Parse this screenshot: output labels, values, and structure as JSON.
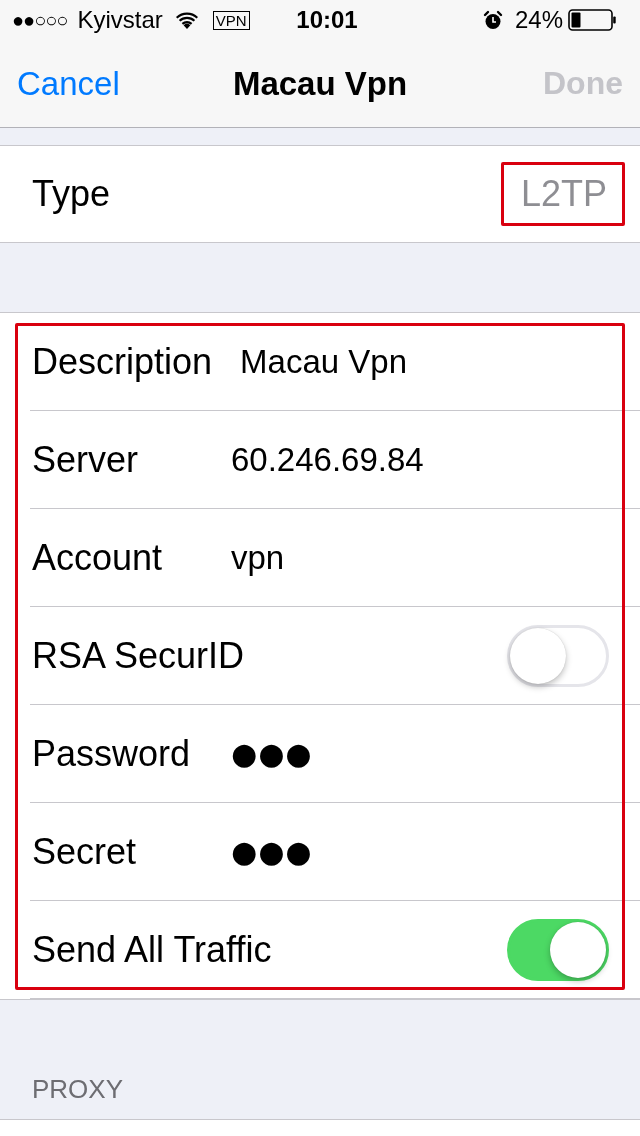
{
  "status_bar": {
    "signal": "●●○○○",
    "carrier": "Kyivstar",
    "vpn": "VPN",
    "time": "10:01",
    "battery": "24%"
  },
  "nav_bar": {
    "cancel": "Cancel",
    "title": "Macau Vpn",
    "done": {
      "label": "Done",
      "disabled": true
    }
  },
  "type_row": {
    "label": "Type",
    "value": "L2TP",
    "highlighted": true
  },
  "fields": {
    "highlighted": true,
    "rows": [
      {
        "kind": "text",
        "label": "Description",
        "value": "Macau Vpn"
      },
      {
        "kind": "text",
        "label": "Server",
        "value": "60.246.69.84"
      },
      {
        "kind": "text",
        "label": "Account",
        "value": "vpn"
      },
      {
        "kind": "toggle",
        "label": "RSA SecurID",
        "on": false
      },
      {
        "kind": "secure",
        "label": "Password",
        "value": "●●●"
      },
      {
        "kind": "secure",
        "label": "Secret",
        "value": "●●●"
      },
      {
        "kind": "toggle",
        "label": "Send All Traffic",
        "on": true
      }
    ]
  },
  "proxy_header": "PROXY"
}
